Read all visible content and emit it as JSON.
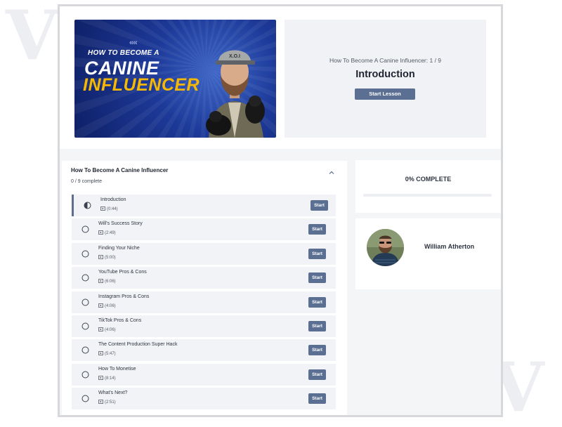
{
  "watermark": {
    "left": "V",
    "right": "V"
  },
  "hero": {
    "thumbnail": {
      "arrows": "‹‹‹‹",
      "line1": "HOW TO BECOME A",
      "line2": "CANINE",
      "line3": "INFLUENCER",
      "hat_text": "X.O.I",
      "accent_color": "#f6b800",
      "bg_color": "#1d3a99"
    },
    "breadcrumb": "How To Become A Canine Influencer: 1 / 9",
    "lesson_title": "Introduction",
    "start_lesson_label": "Start Lesson"
  },
  "course": {
    "title": "How To Become A Canine Influencer",
    "progress_text": "0 / 9 complete",
    "collapse_icon": "chevron-up-icon",
    "lessons": [
      {
        "title": "Introduction",
        "duration": "(0:44)",
        "status": "in-progress",
        "button": "Start"
      },
      {
        "title": "Will's Success Story",
        "duration": "(2:49)",
        "status": "not-started",
        "button": "Start"
      },
      {
        "title": "Finding Your Niche",
        "duration": "(5:00)",
        "status": "not-started",
        "button": "Start"
      },
      {
        "title": "YouTube Pros & Cons",
        "duration": "(6:06)",
        "status": "not-started",
        "button": "Start"
      },
      {
        "title": "Instagram Pros & Cons",
        "duration": "(4:06)",
        "status": "not-started",
        "button": "Start"
      },
      {
        "title": "TikTok Pros & Cons",
        "duration": "(4:06)",
        "status": "not-started",
        "button": "Start"
      },
      {
        "title": "The Content Production Super Hack",
        "duration": "(5:47)",
        "status": "not-started",
        "button": "Start"
      },
      {
        "title": "How To Monetise",
        "duration": "(8:14)",
        "status": "not-started",
        "button": "Start"
      },
      {
        "title": "What's Next?",
        "duration": "(2:51)",
        "status": "not-started",
        "button": "Start"
      }
    ]
  },
  "progress": {
    "label": "0% COMPLETE",
    "percent": 0
  },
  "instructor": {
    "name": "William Atherton"
  },
  "colors": {
    "accent": "#5b6f93",
    "panel": "#f0f2f6",
    "page_bg": "#f4f5f7"
  }
}
